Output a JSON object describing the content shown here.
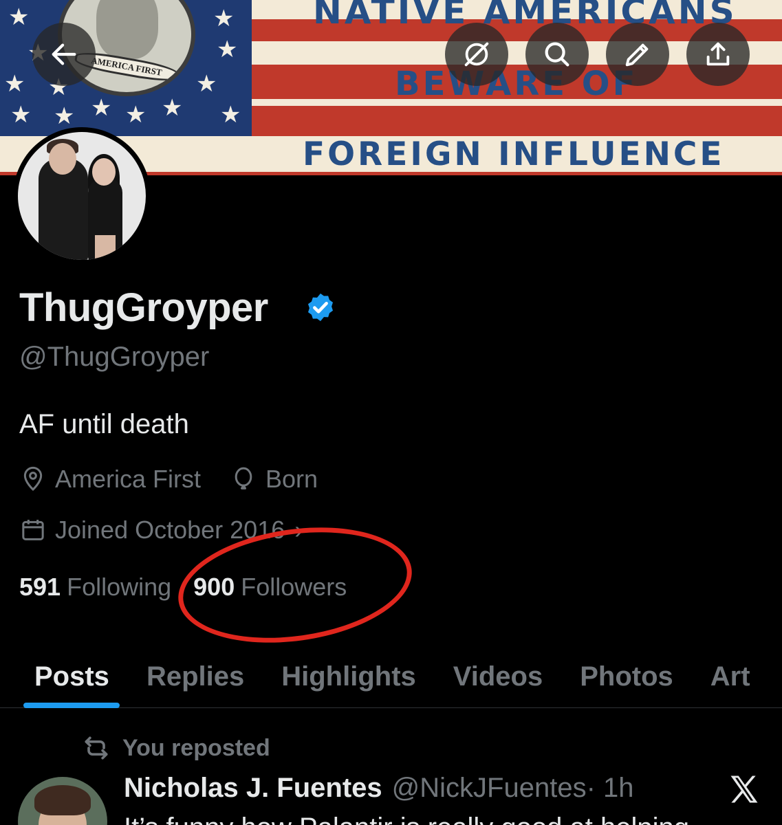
{
  "banner": {
    "line1": "NATIVE AMERICANS",
    "line2": "BEWARE OF",
    "line3": "FOREIGN INFLUENCE",
    "seal_text": "AMERICA FIRST",
    "colors": {
      "red": "#c0392b",
      "blue": "#1f3a72",
      "cream": "#f3ead7",
      "text_blue": "#264f86"
    }
  },
  "header": {
    "back_icon": "arrow-left-icon",
    "grok_icon": "grok-icon",
    "search_icon": "search-icon",
    "edit_icon": "pencil-icon",
    "share_icon": "share-icon"
  },
  "profile": {
    "display_name": "ThugGroyper",
    "verified": true,
    "handle": "@ThugGroyper",
    "bio": "AF until death",
    "location": "America First",
    "birth": "Born",
    "joined": "Joined October 2016",
    "joined_chevron": "›",
    "following_count": "591",
    "following_label": "Following",
    "followers_count": "900",
    "followers_label": "Followers"
  },
  "tabs": [
    {
      "label": "Posts",
      "active": true
    },
    {
      "label": "Replies",
      "active": false
    },
    {
      "label": "Highlights",
      "active": false
    },
    {
      "label": "Videos",
      "active": false
    },
    {
      "label": "Photos",
      "active": false
    },
    {
      "label": "Art",
      "active": false
    }
  ],
  "post": {
    "repost_label": "You reposted",
    "author": "Nicholas J. Fuentes",
    "handle": "@NickJFuentes",
    "time": " · 1h",
    "text": "It’s funny how Palantir is really good at helping"
  },
  "colors": {
    "accent": "#1d9bf0",
    "annotation": "#e0261d",
    "muted": "#71767b",
    "text": "#e7e9ea"
  }
}
